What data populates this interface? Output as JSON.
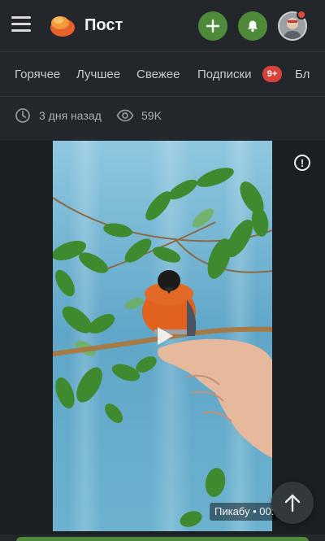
{
  "header": {
    "title": "Пост",
    "icons": {
      "menu": "menu-icon",
      "logo": "pikabu-logo",
      "add": "plus-icon",
      "notifications": "bell-icon",
      "avatar": "user-avatar"
    },
    "accent_color": "#4f8a3b",
    "notification_dot_color": "#e0493a"
  },
  "tabs": {
    "items": [
      {
        "label": "Горячее"
      },
      {
        "label": "Лучшее"
      },
      {
        "label": "Свежее"
      },
      {
        "label": "Подписки"
      },
      {
        "label": "Бл"
      }
    ],
    "subscriptions_badge": "9+",
    "badge_color": "#d8423a"
  },
  "post_meta": {
    "time": "3 дня назад",
    "views": "59K",
    "icons": {
      "time": "clock-icon",
      "views": "eye-icon"
    }
  },
  "video": {
    "watermark": "Пикабу • 00:",
    "icons": {
      "info": "info-icon",
      "play": "play-icon",
      "scroll_top": "arrow-up-icon"
    },
    "info_symbol": "!"
  }
}
